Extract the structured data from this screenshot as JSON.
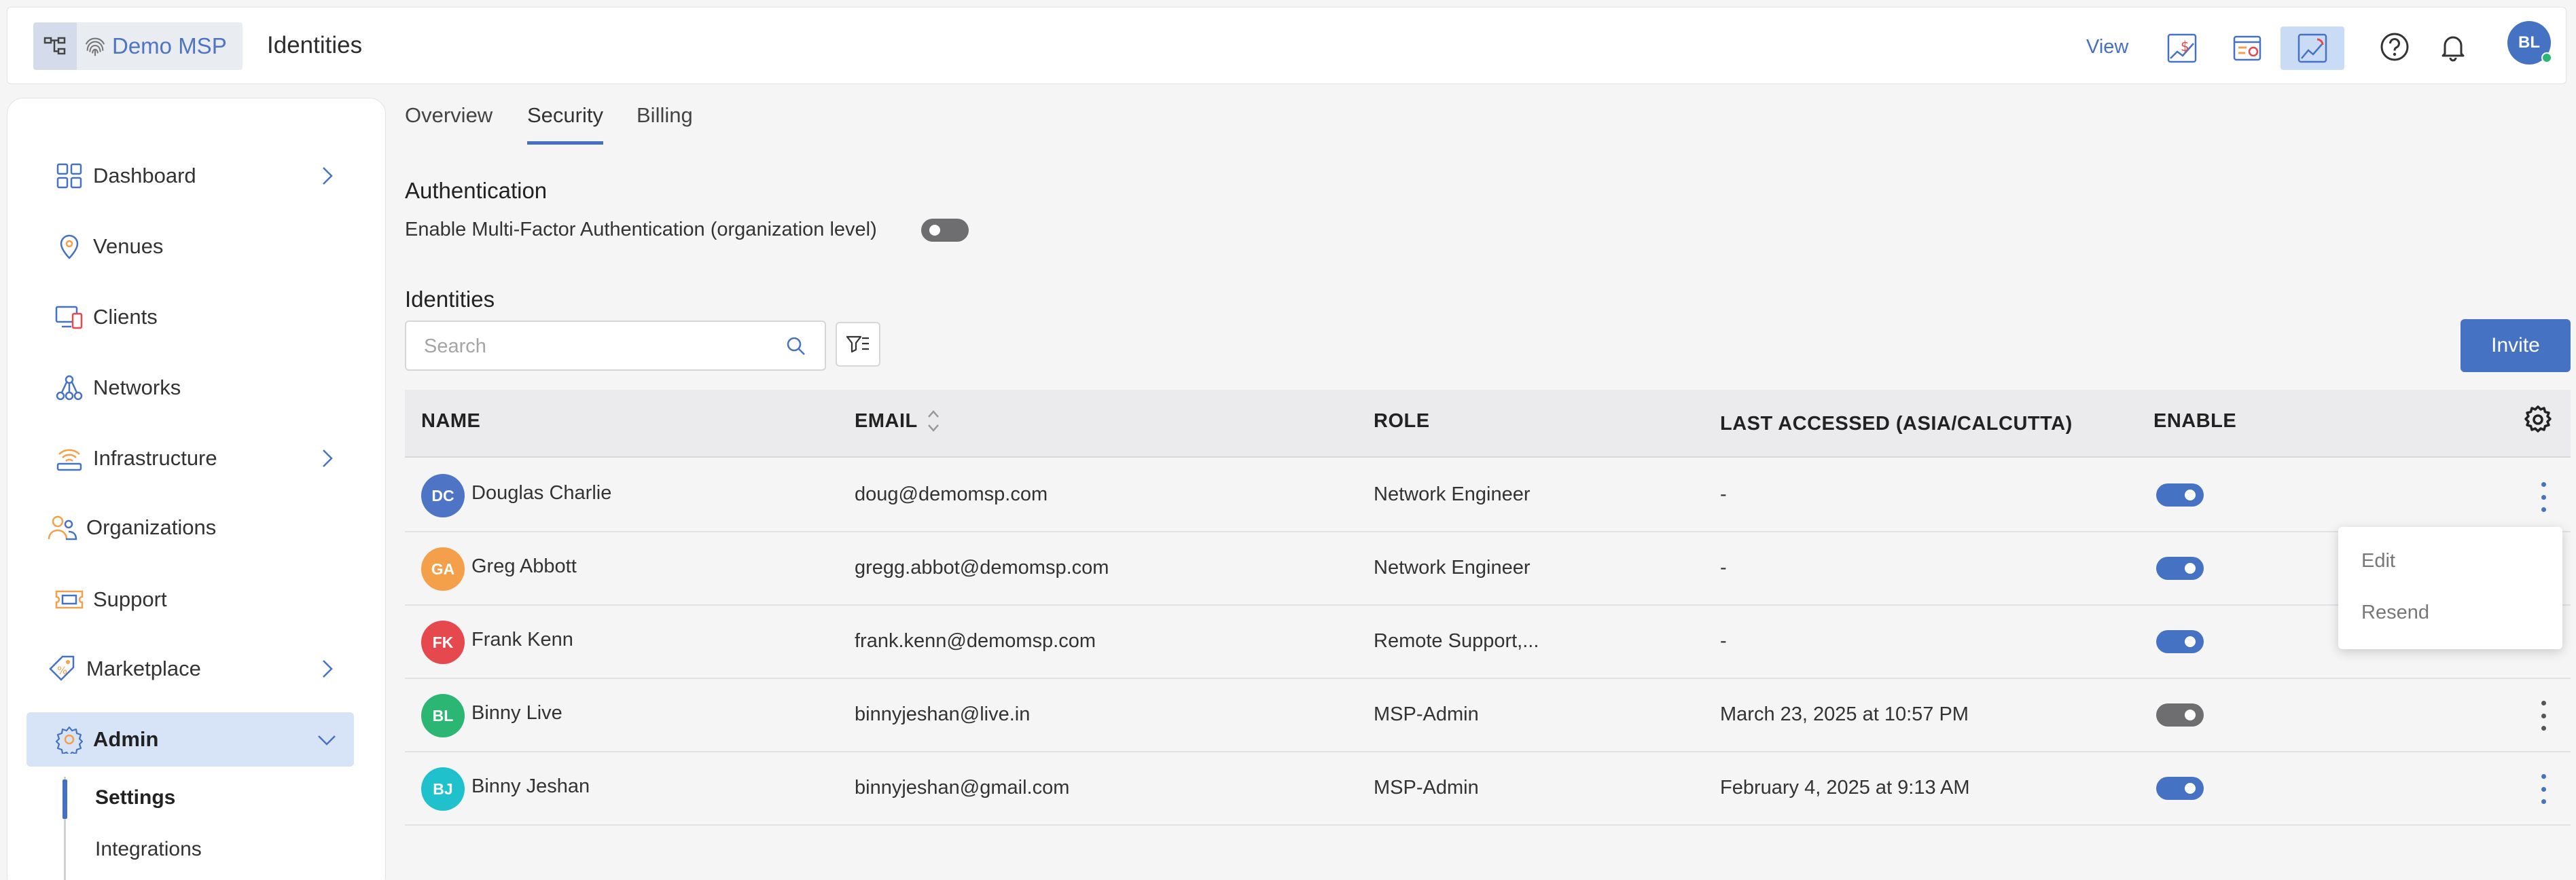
{
  "header": {
    "brand_name": "Demo MSP",
    "page_title": "Identities",
    "view_label": "View",
    "avatar_initials": "BL",
    "icons": [
      "hierarchy-icon",
      "fingerprint-logo-icon",
      "billing-view-icon",
      "report-view-icon",
      "chart-view-icon",
      "help-icon",
      "bell-icon"
    ]
  },
  "sidebar": {
    "items": [
      {
        "label": "Dashboard",
        "icon": "dashboard-icon",
        "has_chevron": true
      },
      {
        "label": "Venues",
        "icon": "location-pin-icon",
        "has_chevron": false
      },
      {
        "label": "Clients",
        "icon": "devices-icon",
        "has_chevron": false
      },
      {
        "label": "Networks",
        "icon": "network-icon",
        "has_chevron": false
      },
      {
        "label": "Infrastructure",
        "icon": "wifi-router-icon",
        "has_chevron": true
      },
      {
        "label": "Organizations",
        "icon": "organizations-icon",
        "has_chevron": false
      },
      {
        "label": "Support",
        "icon": "ticket-icon",
        "has_chevron": false
      },
      {
        "label": "Marketplace",
        "icon": "tag-icon",
        "has_chevron": true
      },
      {
        "label": "Admin",
        "icon": "admin-gear-icon",
        "has_chevron": true,
        "active": true
      }
    ],
    "sub_items": [
      {
        "label": "Settings",
        "active": true
      },
      {
        "label": "Integrations",
        "active": false
      }
    ]
  },
  "tabs": [
    {
      "label": "Overview",
      "active": false
    },
    {
      "label": "Security",
      "active": true
    },
    {
      "label": "Billing",
      "active": false
    }
  ],
  "authentication": {
    "heading": "Authentication",
    "mfa_label": "Enable Multi-Factor Authentication (organization level)",
    "mfa_enabled": false
  },
  "identities": {
    "heading": "Identities",
    "search_placeholder": "Search",
    "invite_label": "Invite",
    "columns": [
      "NAME",
      "EMAIL",
      "ROLE",
      "LAST ACCESSED (ASIA/CALCUTTA)",
      "ENABLE"
    ],
    "rows": [
      {
        "initials": "DC",
        "avatar_color": "#4e74c6",
        "name": "Douglas Charlie",
        "email": "doug@demomsp.com",
        "role": "Network Engineer",
        "last_accessed": "-",
        "enabled": true
      },
      {
        "initials": "GA",
        "avatar_color": "#f4a04a",
        "name": "Greg Abbott",
        "email": "gregg.abbot@demomsp.com",
        "role": "Network Engineer",
        "last_accessed": "-",
        "enabled": true
      },
      {
        "initials": "FK",
        "avatar_color": "#e5484d",
        "name": "Frank Kenn",
        "email": "frank.kenn@demomsp.com",
        "role": "Remote Support,...",
        "last_accessed": "-",
        "enabled": true
      },
      {
        "initials": "BL",
        "avatar_color": "#2bb673",
        "name": "Binny Live",
        "email": "binnyjeshan@live.in",
        "role": "MSP-Admin",
        "last_accessed": "March 23, 2025 at 10:57 PM",
        "enabled": false
      },
      {
        "initials": "BJ",
        "avatar_color": "#1fc2cc",
        "name": "Binny Jeshan",
        "email": "binnyjeshan@gmail.com",
        "role": "MSP-Admin",
        "last_accessed": "February 4, 2025 at 9:13 AM",
        "enabled": true
      }
    ]
  },
  "row_menu": {
    "items": [
      "Edit",
      "Resend"
    ]
  },
  "colors": {
    "accent": "#4672c4",
    "active_nav_bg": "#d7e4f7",
    "toggle_off": "#6e6e70"
  }
}
